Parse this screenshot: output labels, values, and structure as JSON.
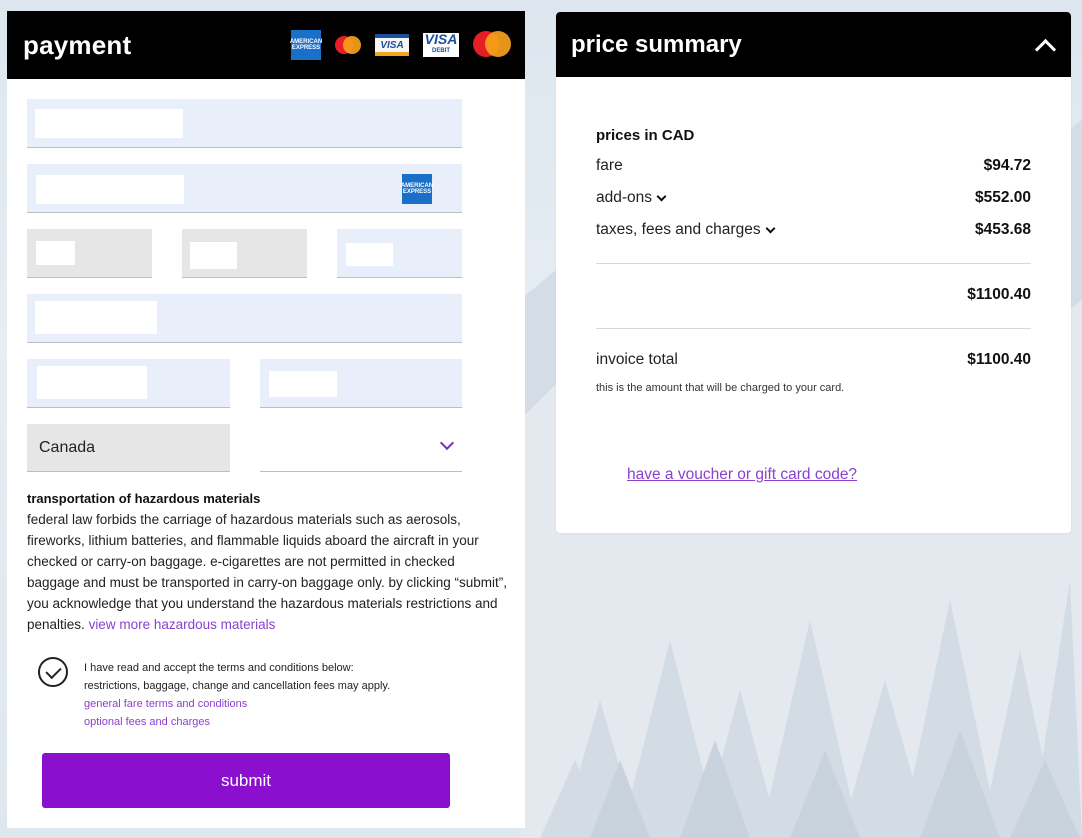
{
  "payment": {
    "title": "payment",
    "card_logos": [
      "amex-icon",
      "mastercard-small-icon",
      "visa-icon",
      "visa-debit-icon",
      "mastercard-icon"
    ],
    "amex_text": "AMERICAN EXPRESS",
    "visa_text": "VISA",
    "visa_debit_text": "VISA",
    "visa_debit_sub": "DEBIT",
    "country_value": "Canada",
    "hazmat": {
      "title": "transportation of hazardous materials",
      "body": "federal law forbids the carriage of hazardous materials such as aerosols, fireworks, lithium batteries, and flammable liquids aboard the aircraft in your checked or carry-on baggage. e-cigarettes are not permitted in checked baggage and must be transported in carry-on baggage only. by clicking “submit”, you acknowledge that you understand the hazardous materials restrictions and penalties.",
      "link": "view more hazardous materials"
    },
    "terms": {
      "line1": "I have read and accept the terms and conditions below:",
      "line2": "restrictions, baggage, change and cancellation fees may apply.",
      "link1": "general fare terms and conditions",
      "link2": "optional fees and charges"
    },
    "submit_label": "submit"
  },
  "summary": {
    "title": "price summary",
    "currency_label": "prices in CAD",
    "rows": [
      {
        "label": "fare",
        "value": "$94.72"
      },
      {
        "label": "add-ons",
        "value": "$552.00"
      },
      {
        "label": "taxes, fees and charges",
        "value": "$453.68"
      }
    ],
    "subtotal": "$1100.40",
    "invoice_label": "invoice total",
    "invoice_value": "$1100.40",
    "invoice_note": "this is the amount that will be charged to your card.",
    "voucher_link": "have a voucher or gift card code?"
  },
  "colors": {
    "accent": "#8a0fcf",
    "link": "#8b3fcf",
    "header_bg": "#000000",
    "field_blue": "#e8effb",
    "field_grey": "#e6e6e6"
  }
}
